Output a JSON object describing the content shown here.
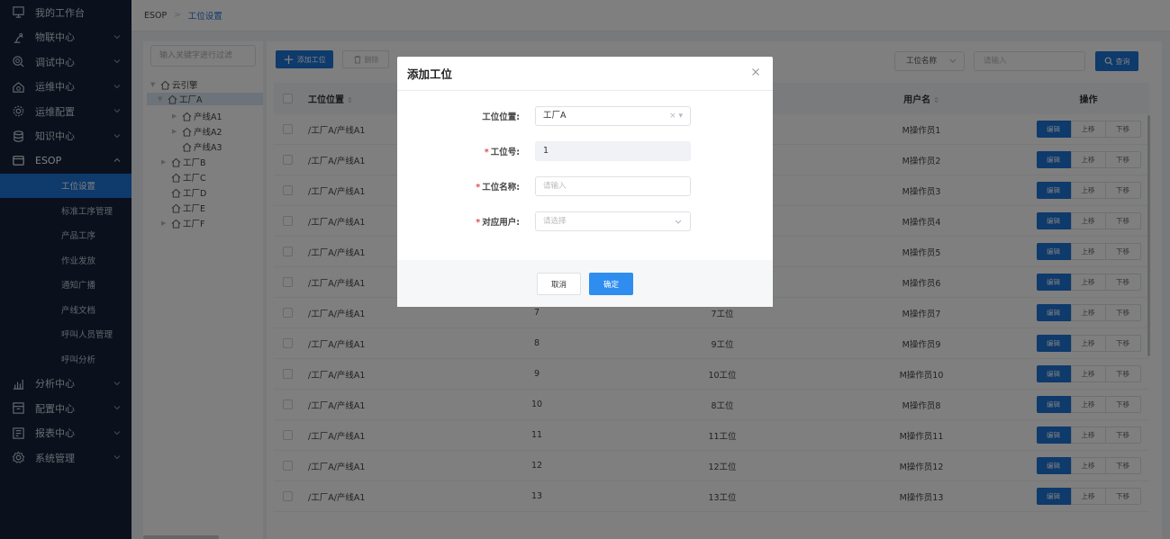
{
  "sidebar": {
    "items": [
      {
        "label": "我的工作台",
        "icon": "monitor-icon",
        "has_chevron": false
      },
      {
        "label": "物联中心",
        "icon": "robot-arm-icon",
        "has_chevron": true
      },
      {
        "label": "调试中心",
        "icon": "target-search-icon",
        "has_chevron": true
      },
      {
        "label": "运维中心",
        "icon": "house-gear-icon",
        "has_chevron": true
      },
      {
        "label": "运维配置",
        "icon": "gear-icon",
        "has_chevron": true
      },
      {
        "label": "知识中心",
        "icon": "database-icon",
        "has_chevron": true
      },
      {
        "label": "ESOP",
        "icon": "esop-icon",
        "has_chevron": true
      }
    ],
    "esop_subitems": [
      "工位设置",
      "标准工序管理",
      "产品工序",
      "作业发放",
      "通知广播",
      "产线文档",
      "呼叫人员管理",
      "呼叫分析"
    ],
    "active_subitem": "工位设置",
    "bottom_items": [
      {
        "label": "分析中心",
        "icon": "bar-chart-icon"
      },
      {
        "label": "配置中心",
        "icon": "config-icon"
      },
      {
        "label": "报表中心",
        "icon": "report-icon"
      },
      {
        "label": "系统管理",
        "icon": "settings-icon"
      }
    ]
  },
  "breadcrumb": {
    "root": "ESOP",
    "current": "工位设置"
  },
  "tree": {
    "search_placeholder": "输入关键字进行过滤",
    "nodes": [
      {
        "label": "云引擎"
      },
      {
        "label": "工厂A"
      },
      {
        "label": "产线A1"
      },
      {
        "label": "产线A2"
      },
      {
        "label": "产线A3"
      },
      {
        "label": "工厂B"
      },
      {
        "label": "工厂C"
      },
      {
        "label": "工厂D"
      },
      {
        "label": "工厂E"
      },
      {
        "label": "工厂F"
      }
    ]
  },
  "toolbar": {
    "add_label": "添加工位",
    "delete_label": "删除",
    "field_select": "工位名称",
    "search_placeholder": "请输入",
    "query_label": "查询"
  },
  "table": {
    "headers": {
      "position": "工位位置",
      "user": "用户名",
      "ops": "操作"
    },
    "rows": [
      {
        "position": "/工厂A/产线A1",
        "no": "",
        "name": "",
        "user": "M操作员1"
      },
      {
        "position": "/工厂A/产线A1",
        "no": "",
        "name": "",
        "user": "M操作员2"
      },
      {
        "position": "/工厂A/产线A1",
        "no": "",
        "name": "",
        "user": "M操作员3"
      },
      {
        "position": "/工厂A/产线A1",
        "no": "",
        "name": "",
        "user": "M操作员4"
      },
      {
        "position": "/工厂A/产线A1",
        "no": "",
        "name": "",
        "user": "M操作员5"
      },
      {
        "position": "/工厂A/产线A1",
        "no": "",
        "name": "",
        "user": "M操作员6"
      },
      {
        "position": "/工厂A/产线A1",
        "no": "7",
        "name": "7工位",
        "user": "M操作员7"
      },
      {
        "position": "/工厂A/产线A1",
        "no": "8",
        "name": "9工位",
        "user": "M操作员9"
      },
      {
        "position": "/工厂A/产线A1",
        "no": "9",
        "name": "10工位",
        "user": "M操作员10"
      },
      {
        "position": "/工厂A/产线A1",
        "no": "10",
        "name": "8工位",
        "user": "M操作员8"
      },
      {
        "position": "/工厂A/产线A1",
        "no": "11",
        "name": "11工位",
        "user": "M操作员11"
      },
      {
        "position": "/工厂A/产线A1",
        "no": "12",
        "name": "12工位",
        "user": "M操作员12"
      },
      {
        "position": "/工厂A/产线A1",
        "no": "13",
        "name": "13工位",
        "user": "M操作员13"
      }
    ],
    "op_labels": {
      "edit": "编辑",
      "up": "上移",
      "down": "下移"
    }
  },
  "modal": {
    "title": "添加工位",
    "fields": {
      "position": {
        "label": "工位位置:",
        "value": "工厂A",
        "required": false
      },
      "number": {
        "label": "工位号:",
        "value": "1",
        "required": true
      },
      "name": {
        "label": "工位名称:",
        "placeholder": "请输入",
        "required": true
      },
      "user": {
        "label": "对应用户:",
        "placeholder": "请选择",
        "required": true
      }
    },
    "cancel_label": "取消",
    "ok_label": "确定"
  },
  "colors": {
    "primary": "#1c75d8",
    "sidebar_bg": "#15233a",
    "required": "#e24b4b"
  }
}
